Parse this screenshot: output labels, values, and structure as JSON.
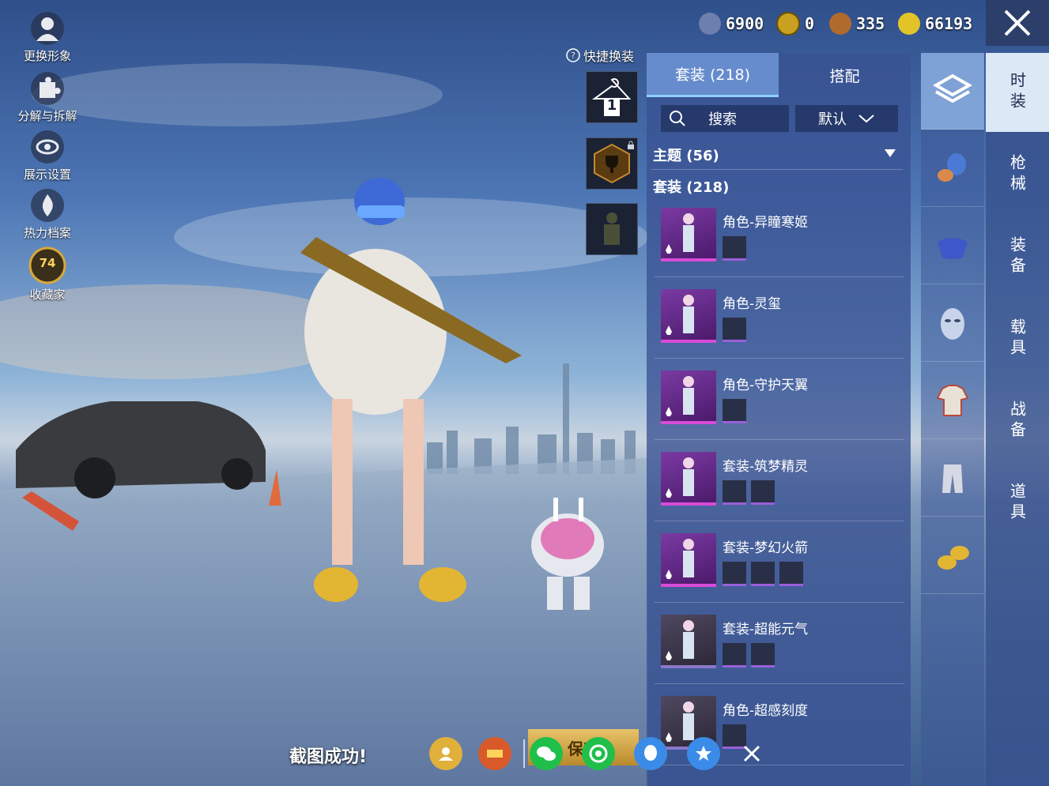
{
  "left_menu": [
    {
      "label": "更换形象",
      "icon": "avatar-icon"
    },
    {
      "label": "分解与拆解",
      "icon": "puzzle-icon"
    },
    {
      "label": "展示设置",
      "icon": "eye-icon"
    },
    {
      "label": "热力档案",
      "icon": "flame-icon"
    },
    {
      "label": "收藏家",
      "icon": "collector-badge-icon",
      "badge": "74"
    }
  ],
  "currency": [
    {
      "value": "6900",
      "icon": "uc-coin-icon",
      "color": "#6d7fae"
    },
    {
      "value": "0",
      "icon": "ag-coin-icon",
      "color": "#c9a020"
    },
    {
      "value": "335",
      "icon": "bronze-coin-icon",
      "color": "#b06a2c"
    },
    {
      "value": "66193",
      "icon": "bp-coin-icon",
      "color": "#e2c428"
    }
  ],
  "quick_change": {
    "label": "快捷换装",
    "slot1": "1"
  },
  "panel": {
    "tabs": [
      {
        "label": "套装 (218)"
      },
      {
        "label": "搭配"
      }
    ],
    "search_label": "搜索",
    "sort_label": "默认",
    "section_theme": "主题 (56)",
    "section_suit": "套装 (218)",
    "items": [
      {
        "name": "角色-异瞳寒姬",
        "subs": 1,
        "style": "purple"
      },
      {
        "name": "角色-灵玺",
        "subs": 1,
        "style": "purple"
      },
      {
        "name": "角色-守护天翼",
        "subs": 1,
        "style": "purple"
      },
      {
        "name": "套装-筑梦精灵",
        "subs": 2,
        "style": "purple"
      },
      {
        "name": "套装-梦幻火箭",
        "subs": 3,
        "style": "purple"
      },
      {
        "name": "套装-超能元气",
        "subs": 2,
        "style": "plain"
      },
      {
        "name": "角色-超感刻度",
        "subs": 1,
        "style": "plain"
      }
    ]
  },
  "vertical_tabs": [
    "时装",
    "枪械",
    "装备",
    "载具",
    "战备",
    "道具"
  ],
  "bottom": {
    "screenshot_text": "截图成功!",
    "save_label": "保存"
  },
  "colors": {
    "panel": "#3a5292",
    "accent": "#8fd0ff",
    "rarity": "#d84bd8"
  }
}
